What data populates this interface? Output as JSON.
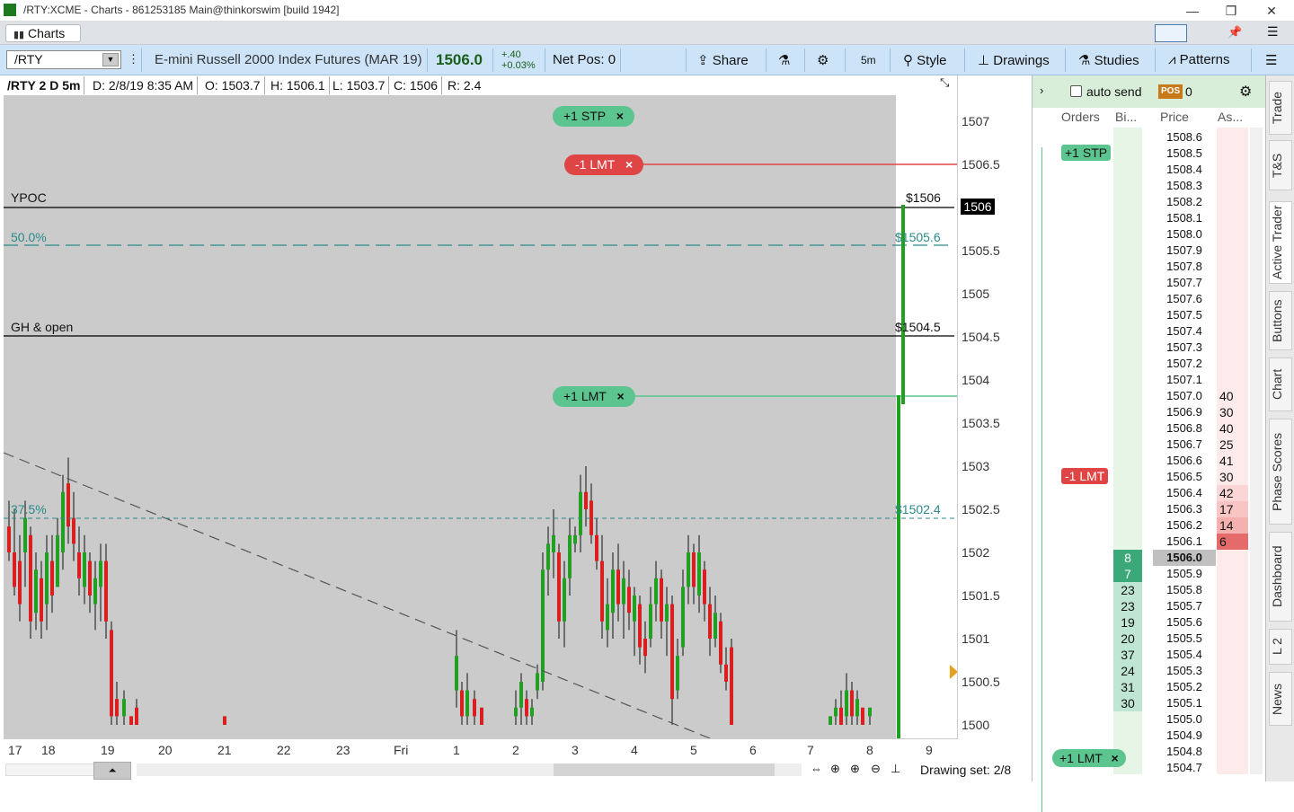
{
  "window": {
    "title": "/RTY:XCME - Charts - 861253185 Main@thinkorswim [build 1942]",
    "minimize": "—",
    "restore": "❐",
    "close": "✕"
  },
  "tabs": {
    "charts": "Charts"
  },
  "toolbar": {
    "symbol": "/RTY",
    "description": "E-mini Russell 2000 Index Futures (MAR 19)",
    "last_price": "1506.0",
    "change": "+.40",
    "change_pct": "+0.03%",
    "net_pos": "Net Pos: 0",
    "share": "Share",
    "timeframe": "5m",
    "style": "Style",
    "drawings": "Drawings",
    "studies": "Studies",
    "patterns": "Patterns"
  },
  "infobar": {
    "symbol": "/RTY 2 D 5m",
    "date": "D: 2/8/19 8:35 AM",
    "open": "O: 1503.7",
    "high": "H: 1506.1",
    "low": "L: 1503.7",
    "close": "C: 1506",
    "range": "R: 2.4"
  },
  "chart": {
    "price_ticks": [
      "1507",
      "1506.5",
      "1506",
      "1505.5",
      "1505",
      "1504.5",
      "1504",
      "1503.5",
      "1503",
      "1502.5",
      "1502",
      "1501.5",
      "1501",
      "1500.5",
      "1500"
    ],
    "time_ticks": [
      "17",
      "18",
      "19",
      "20",
      "21",
      "22",
      "23",
      "Fri",
      "1",
      "2",
      "3",
      "4",
      "5",
      "6",
      "7",
      "8",
      "9"
    ],
    "current_price_badge": "1506",
    "lines": {
      "ypoc": "YPOC",
      "ypoc_price": "$1506",
      "fib50": "50.0%",
      "fib50_price": "$1505.6",
      "gh_open": "GH & open",
      "gh_price": "$1504.5",
      "fib375": "37.5%",
      "fib375_price": "$1502.4"
    },
    "orders": {
      "stp": "+1 STP",
      "lmt_sell": "-1 LMT",
      "lmt_buy": "+1 LMT"
    }
  },
  "bottom": {
    "drawing_set": "Drawing set: 2/8"
  },
  "dom": {
    "auto_send": "auto send",
    "pos_badge": "POS",
    "pos_value": "0",
    "col_orders": "Orders",
    "col_bid": "Bi...",
    "col_price": "Price",
    "col_ask": "As...",
    "rows": [
      {
        "p": "1508.6",
        "b": "",
        "a": ""
      },
      {
        "p": "1508.5",
        "b": "",
        "a": ""
      },
      {
        "p": "1508.4",
        "b": "",
        "a": ""
      },
      {
        "p": "1508.3",
        "b": "",
        "a": ""
      },
      {
        "p": "1508.2",
        "b": "",
        "a": ""
      },
      {
        "p": "1508.1",
        "b": "",
        "a": ""
      },
      {
        "p": "1508.0",
        "b": "",
        "a": ""
      },
      {
        "p": "1507.9",
        "b": "",
        "a": ""
      },
      {
        "p": "1507.8",
        "b": "",
        "a": ""
      },
      {
        "p": "1507.7",
        "b": "",
        "a": ""
      },
      {
        "p": "1507.6",
        "b": "",
        "a": ""
      },
      {
        "p": "1507.5",
        "b": "",
        "a": ""
      },
      {
        "p": "1507.4",
        "b": "",
        "a": ""
      },
      {
        "p": "1507.3",
        "b": "",
        "a": ""
      },
      {
        "p": "1507.2",
        "b": "",
        "a": ""
      },
      {
        "p": "1507.1",
        "b": "",
        "a": ""
      },
      {
        "p": "1507.0",
        "b": "",
        "a": "40"
      },
      {
        "p": "1506.9",
        "b": "",
        "a": "30"
      },
      {
        "p": "1506.8",
        "b": "",
        "a": "40"
      },
      {
        "p": "1506.7",
        "b": "",
        "a": "25"
      },
      {
        "p": "1506.6",
        "b": "",
        "a": "41"
      },
      {
        "p": "1506.5",
        "b": "",
        "a": "30"
      },
      {
        "p": "1506.4",
        "b": "",
        "a": "42"
      },
      {
        "p": "1506.3",
        "b": "",
        "a": "17"
      },
      {
        "p": "1506.2",
        "b": "",
        "a": "14"
      },
      {
        "p": "1506.1",
        "b": "",
        "a": "6"
      },
      {
        "p": "1506.0",
        "b": "8",
        "a": ""
      },
      {
        "p": "1505.9",
        "b": "7",
        "a": ""
      },
      {
        "p": "1505.8",
        "b": "23",
        "a": ""
      },
      {
        "p": "1505.7",
        "b": "23",
        "a": ""
      },
      {
        "p": "1505.6",
        "b": "19",
        "a": ""
      },
      {
        "p": "1505.5",
        "b": "20",
        "a": ""
      },
      {
        "p": "1505.4",
        "b": "37",
        "a": ""
      },
      {
        "p": "1505.3",
        "b": "24",
        "a": ""
      },
      {
        "p": "1505.2",
        "b": "31",
        "a": ""
      },
      {
        "p": "1505.1",
        "b": "30",
        "a": ""
      },
      {
        "p": "1505.0",
        "b": "",
        "a": ""
      },
      {
        "p": "1504.9",
        "b": "",
        "a": ""
      },
      {
        "p": "1504.8",
        "b": "",
        "a": ""
      },
      {
        "p": "1504.7",
        "b": "",
        "a": ""
      }
    ],
    "order_stp": "+1 STP",
    "order_lmt_sell": "-1 LMT",
    "order_lmt_buy": "+1 LMT"
  },
  "side_tabs": [
    "Trade",
    "T&S",
    "Active Trader",
    "Buttons",
    "Chart",
    "Phase Scores",
    "Dashboard",
    "L 2",
    "News"
  ],
  "colors": {
    "bull": "#22a022",
    "bear": "#d91f1f",
    "accent": "#cde3f7"
  }
}
